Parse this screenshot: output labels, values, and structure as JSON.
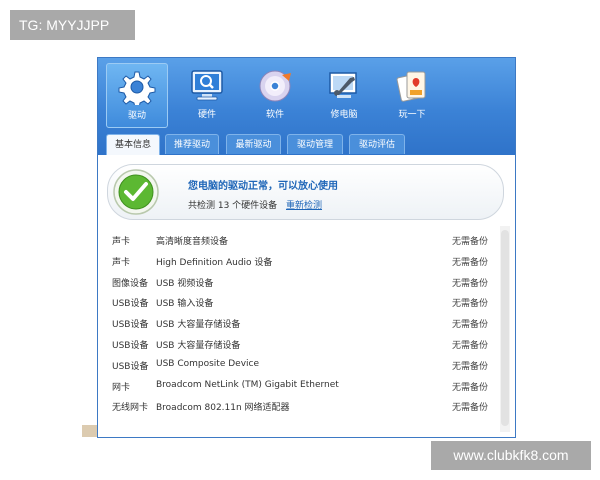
{
  "watermarks": {
    "top": "TG: MYYJJPP",
    "bottom": "www.clubkfk8.com"
  },
  "toolbar": [
    {
      "label": "驱动",
      "icon": "gear-icon",
      "active": true
    },
    {
      "label": "硬件",
      "icon": "monitor-search-icon"
    },
    {
      "label": "软件",
      "icon": "disc-icon"
    },
    {
      "label": "修电脑",
      "icon": "wrench-screen-icon"
    },
    {
      "label": "玩一下",
      "icon": "playing-cards-icon"
    }
  ],
  "tabs": [
    "基本信息",
    "推荐驱动",
    "最新驱动",
    "驱动管理",
    "驱动评估"
  ],
  "active_tab": "基本信息",
  "status": {
    "title": "您电脑的驱动正常，可以放心使用",
    "detail": "共检测 13 个硬件设备",
    "link": "重新检测"
  },
  "devices": [
    {
      "category": "声卡",
      "name": "高清晰度音频设备",
      "status": "无需备份"
    },
    {
      "category": "声卡",
      "name": "High Definition Audio 设备",
      "status": "无需备份"
    },
    {
      "category": "图像设备",
      "name": "USB 视频设备",
      "status": "无需备份"
    },
    {
      "category": "USB设备",
      "name": "USB 输入设备",
      "status": "无需备份"
    },
    {
      "category": "USB设备",
      "name": "USB 大容量存储设备",
      "status": "无需备份"
    },
    {
      "category": "USB设备",
      "name": "USB 大容量存储设备",
      "status": "无需备份"
    },
    {
      "category": "USB设备",
      "name": "USB Composite Device",
      "status": "无需备份"
    },
    {
      "category": "网卡",
      "name": "Broadcom NetLink (TM) Gigabit Ethernet",
      "status": "无需备份"
    },
    {
      "category": "无线网卡",
      "name": "Broadcom 802.11n 网络适配器",
      "status": "无需备份"
    }
  ],
  "colors": {
    "toolbar_blue": "#3b82d6",
    "link_blue": "#1f66b8",
    "ok_green": "#4caf2a"
  }
}
